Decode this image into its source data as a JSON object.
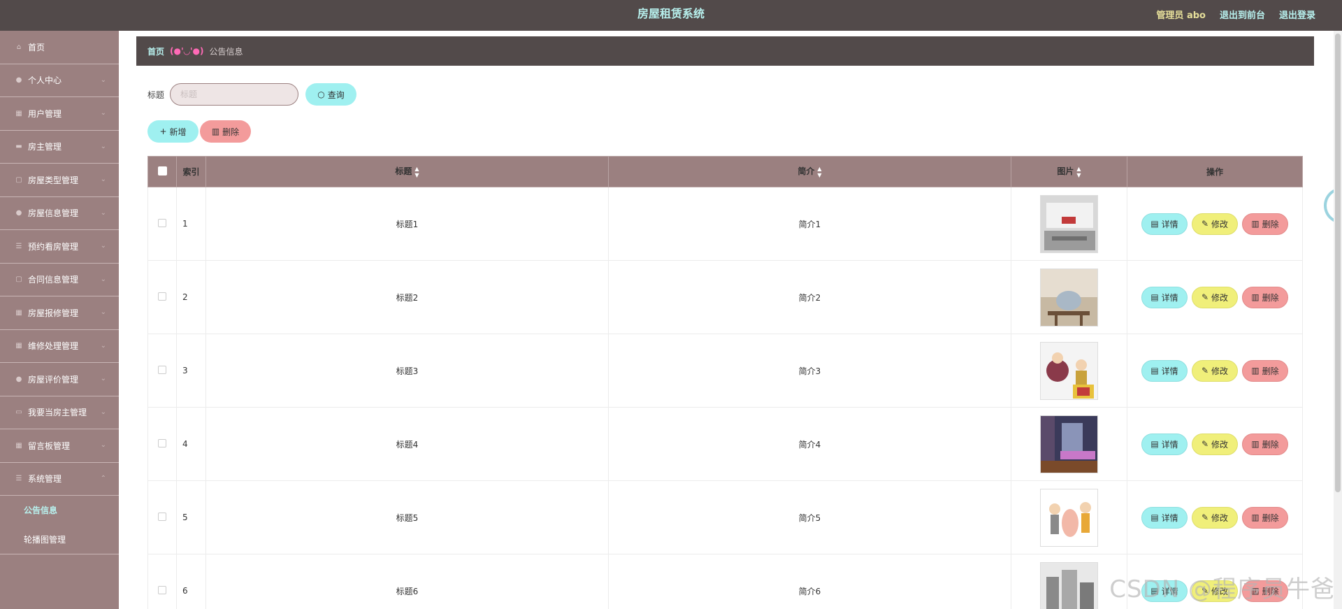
{
  "header": {
    "title": "房屋租赁系统",
    "admin_label": "管理员 abo",
    "to_front": "退出到前台",
    "logout": "退出登录"
  },
  "sidebar": {
    "items": [
      {
        "label": "首页",
        "icon": "home-icon"
      },
      {
        "label": "个人中心",
        "icon": "user-icon"
      },
      {
        "label": "用户管理",
        "icon": "grid-icon"
      },
      {
        "label": "房主管理",
        "icon": "message-icon"
      },
      {
        "label": "房屋类型管理",
        "icon": "doc-icon"
      },
      {
        "label": "房屋信息管理",
        "icon": "user-icon"
      },
      {
        "label": "预约看房管理",
        "icon": "list-icon"
      },
      {
        "label": "合同信息管理",
        "icon": "doc-icon"
      },
      {
        "label": "房屋报修管理",
        "icon": "grid-icon"
      },
      {
        "label": "维修处理管理",
        "icon": "grid-icon"
      },
      {
        "label": "房屋评价管理",
        "icon": "user-icon"
      },
      {
        "label": "我要当房主管理",
        "icon": "window-icon"
      },
      {
        "label": "留言板管理",
        "icon": "grid-icon"
      },
      {
        "label": "系统管理",
        "icon": "list-icon"
      }
    ],
    "sub_items": [
      {
        "label": "公告信息",
        "active": true
      },
      {
        "label": "轮播图管理",
        "active": false
      }
    ]
  },
  "breadcrumb": {
    "home": "首页",
    "face": "(●'◡'●)",
    "current": "公告信息"
  },
  "search": {
    "label": "标题",
    "placeholder": "标题",
    "query_button": "查询"
  },
  "actions": {
    "add": "新增",
    "delete": "删除"
  },
  "table": {
    "columns": {
      "index": "索引",
      "title": "标题",
      "intro": "简介",
      "image": "图片",
      "ops": "操作"
    },
    "rows": [
      {
        "index": "1",
        "title": "标题1",
        "intro": "简介1"
      },
      {
        "index": "2",
        "title": "标题2",
        "intro": "简介2"
      },
      {
        "index": "3",
        "title": "标题3",
        "intro": "简介3"
      },
      {
        "index": "4",
        "title": "标题4",
        "intro": "简介4"
      },
      {
        "index": "5",
        "title": "标题5",
        "intro": "简介5"
      },
      {
        "index": "6",
        "title": "标题6",
        "intro": "简介6"
      }
    ],
    "op_labels": {
      "detail": "详情",
      "edit": "修改",
      "delete": "删除"
    }
  },
  "watermark": "CSDN @程序员牛爸",
  "colors": {
    "header_bg": "#524a4a",
    "sidebar_bg": "#9b8080",
    "accent_cyan": "#9ff0f0",
    "accent_yellow": "#f0ef7a",
    "accent_red": "#f39b9b"
  }
}
